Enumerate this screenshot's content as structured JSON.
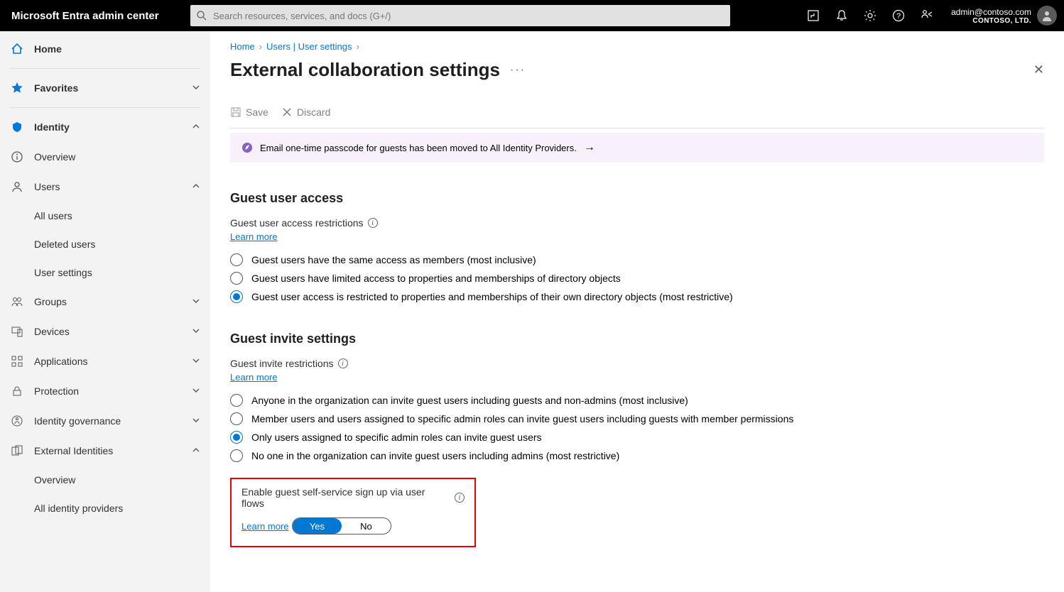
{
  "brand": "Microsoft Entra admin center",
  "search_placeholder": "Search resources, services, and docs (G+/)",
  "account": {
    "email": "admin@contoso.com",
    "org": "CONTOSO, LTD."
  },
  "sidebar": {
    "home": "Home",
    "favorites": "Favorites",
    "identity": "Identity",
    "overview": "Overview",
    "users": "Users",
    "all_users": "All users",
    "deleted_users": "Deleted users",
    "user_settings": "User settings",
    "groups": "Groups",
    "devices": "Devices",
    "applications": "Applications",
    "protection": "Protection",
    "id_gov": "Identity governance",
    "ext_id": "External Identities",
    "ext_overview": "Overview",
    "all_idp": "All identity providers"
  },
  "crumbs": {
    "home": "Home",
    "users": "Users | User settings"
  },
  "page_title": "External collaboration settings",
  "cmd": {
    "save": "Save",
    "discard": "Discard"
  },
  "banner": "Email one-time passcode for guests has been moved to All Identity Providers.",
  "guest_access": {
    "heading": "Guest user access",
    "sub": "Guest user access restrictions",
    "learn": "Learn more",
    "opt1": "Guest users have the same access as members (most inclusive)",
    "opt2": "Guest users have limited access to properties and memberships of directory objects",
    "opt3": "Guest user access is restricted to properties and memberships of their own directory objects (most restrictive)"
  },
  "guest_invite": {
    "heading": "Guest invite settings",
    "sub": "Guest invite restrictions",
    "learn": "Learn more",
    "opt1": "Anyone in the organization can invite guest users including guests and non-admins (most inclusive)",
    "opt2": "Member users and users assigned to specific admin roles can invite guest users including guests with member permissions",
    "opt3": "Only users assigned to specific admin roles can invite guest users",
    "opt4": "No one in the organization can invite guest users including admins (most restrictive)"
  },
  "self_service": {
    "label": "Enable guest self-service sign up via user flows",
    "learn": "Learn more",
    "yes": "Yes",
    "no": "No"
  }
}
